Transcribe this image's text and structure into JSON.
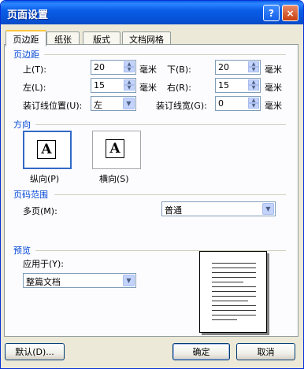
{
  "window": {
    "title": "页面设置",
    "help_label": "?",
    "close_label": "×"
  },
  "tabs": [
    {
      "label": "页边距",
      "active": true
    },
    {
      "label": "纸张",
      "active": false
    },
    {
      "label": "版式",
      "active": false
    },
    {
      "label": "文档网格",
      "active": false
    }
  ],
  "margins": {
    "section_title": "页边距",
    "top_label": "上(T):",
    "top_value": "20",
    "bottom_label": "下(B):",
    "bottom_value": "20",
    "left_label": "左(L):",
    "left_value": "15",
    "right_label": "右(R):",
    "right_value": "15",
    "gutter_pos_label": "装订线位置(U):",
    "gutter_pos_value": "左",
    "gutter_label": "装订线宽(G):",
    "gutter_value": "0",
    "unit": "毫米"
  },
  "orientation": {
    "section_title": "方向",
    "icon_letter": "A",
    "portrait_label": "纵向(P)",
    "landscape_label": "横向(S)"
  },
  "pages": {
    "section_title": "页码范围",
    "multiple_label": "多页(M):",
    "multiple_value": "普通"
  },
  "preview": {
    "section_title": "预览",
    "apply_label": "应用于(Y):",
    "apply_value": "整篇文档"
  },
  "buttons": {
    "default_label": "默认(D)...",
    "ok_label": "确定",
    "cancel_label": "取消"
  }
}
